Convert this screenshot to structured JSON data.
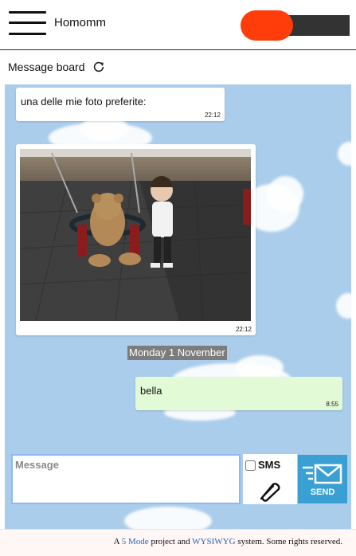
{
  "header": {
    "app_title": "Homomm"
  },
  "subheader": {
    "title": "Message board"
  },
  "messages": [
    {
      "type": "incoming",
      "text": "una delle mie foto preferite:",
      "time": "22:12"
    },
    {
      "type": "incoming-photo",
      "time": "22:12"
    },
    {
      "type": "outgoing",
      "text": "bella",
      "time": "8:55"
    }
  ],
  "date_separator": "Monday 1 November",
  "composer": {
    "placeholder": "Message",
    "sms_label": "SMS",
    "send_label": "SEND"
  },
  "footer": {
    "prefix": "A ",
    "link1": "5 Mode",
    "middle": " project and ",
    "link2": "WYSIWYG",
    "suffix": " system. Some rights reserved."
  },
  "colors": {
    "accent_toggle": "#ff3d0b",
    "chat_bg": "#a9cdeb",
    "send_button": "#3aa0d4",
    "outgoing_bubble": "#e2fbd6"
  }
}
